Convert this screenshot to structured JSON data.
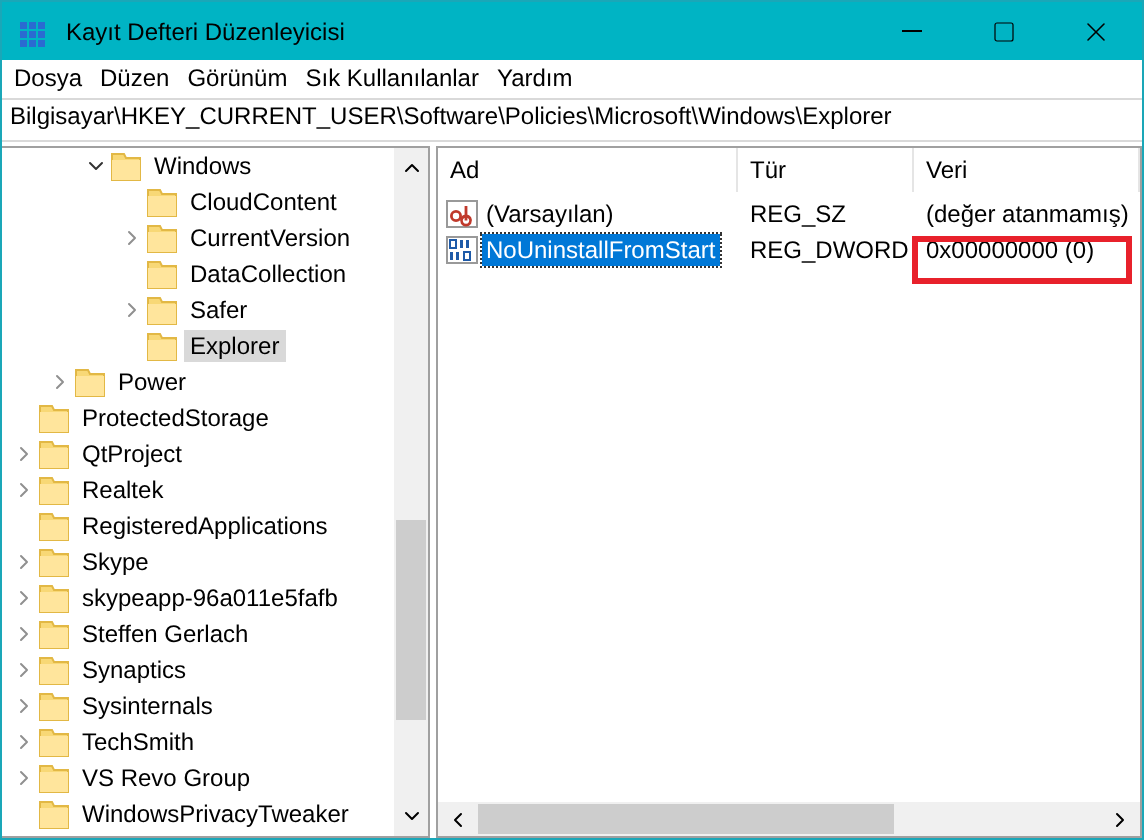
{
  "window": {
    "title": "Kayıt Defteri Düzenleyicisi"
  },
  "menu": [
    "Dosya",
    "Düzen",
    "Görünüm",
    "Sık Kullanılanlar",
    "Yardım"
  ],
  "address": "Bilgisayar\\HKEY_CURRENT_USER\\Software\\Policies\\Microsoft\\Windows\\Explorer",
  "tree": {
    "items": [
      {
        "children": [
          {
            "children": [
              {
                "label": "Windows",
                "expanded": true,
                "selected": false,
                "children": [
                  {
                    "label": "CloudContent",
                    "selected": false
                  },
                  {
                    "label": "CurrentVersion",
                    "expanded": false,
                    "selected": false
                  },
                  {
                    "label": "DataCollection",
                    "selected": false
                  },
                  {
                    "label": "Safer",
                    "expanded": false,
                    "selected": false
                  },
                  {
                    "label": "Explorer",
                    "selected": true
                  }
                ]
              }
            ]
          },
          {
            "label": "Power",
            "expanded": false,
            "selected": false
          }
        ]
      },
      {
        "label": "ProtectedStorage",
        "selected": false
      },
      {
        "label": "QtProject",
        "expanded": false,
        "selected": false
      },
      {
        "label": "Realtek",
        "expanded": false,
        "selected": false
      },
      {
        "label": "RegisteredApplications",
        "selected": false
      },
      {
        "label": "Skype",
        "expanded": false,
        "selected": false
      },
      {
        "label": "skypeapp-96a011e5fafb",
        "expanded": false,
        "selected": false
      },
      {
        "label": "Steffen Gerlach",
        "expanded": false,
        "selected": false
      },
      {
        "label": "Synaptics",
        "expanded": false,
        "selected": false
      },
      {
        "label": "Sysinternals",
        "expanded": false,
        "selected": false
      },
      {
        "label": "TechSmith",
        "expanded": false,
        "selected": false
      },
      {
        "label": "VS Revo Group",
        "expanded": false,
        "selected": false
      },
      {
        "label": "WindowsPrivacyTweaker",
        "selected": false
      }
    ]
  },
  "values": {
    "columns": [
      "Ad",
      "Tür",
      "Veri"
    ],
    "rows": [
      {
        "kind": "string",
        "name": "(Varsayılan)",
        "type": "REG_SZ",
        "data": "(değer atanmamış)",
        "selected": false,
        "highlighted": false
      },
      {
        "kind": "binary",
        "name": "NoUninstallFromStart",
        "type": "REG_DWORD",
        "data": "0x00000000 (0)",
        "selected": true,
        "highlighted": true
      }
    ]
  }
}
